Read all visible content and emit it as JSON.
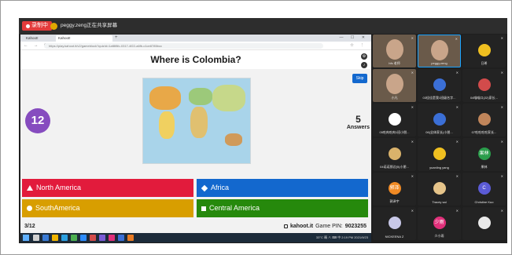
{
  "meeting": {
    "record_label": "录制中",
    "sharer_label": "peggy.zeng正在共享屏幕"
  },
  "browser": {
    "tabs": [
      "Kahoot!",
      "Kahoot!"
    ],
    "url": "https://play.kahoot.it/v2/gameblock?quizId=1af8f8fc-0317-4f22-a6fb-c1ce8785bcc",
    "window_controls": "— ☐ ✕"
  },
  "kahoot": {
    "question": "Where is Colombia?",
    "skip_label": "Skip",
    "timer": "12",
    "answers_count": "5",
    "answers_label": "Answers",
    "choices": [
      {
        "label": "North America",
        "shape": "triangle",
        "color": "#e21b3c"
      },
      {
        "label": "Africa",
        "shape": "diamond",
        "color": "#1368ce"
      },
      {
        "label": "SouthAmerica",
        "shape": "circle",
        "color": "#d89e00"
      },
      {
        "label": "Central America",
        "shape": "square",
        "color": "#26890c"
      }
    ],
    "progress": "3/12",
    "site": "kahoot.it",
    "game_pin_label": "Game PIN:",
    "game_pin": "9023255"
  },
  "taskbar": {
    "tray_text": "33°C 晴 ∧ ⌨ 中 2:19 PM 2021/9/23"
  },
  "participants": [
    {
      "name": "hfs 老师",
      "video": true
    },
    {
      "name": "peggy.zeng",
      "video": true,
      "active": true
    },
    {
      "name": "日希",
      "video": false,
      "avatar_color": "#f0c020"
    },
    {
      "name": "小凡",
      "video": true
    },
    {
      "name": "03佳佳是我1班级名字...",
      "video": false,
      "avatar_color": "#3b6fd6"
    },
    {
      "name": "04喵喵口(22)家长...",
      "video": false,
      "avatar_color": "#d24b4b"
    },
    {
      "name": "05吃肉吃肉1班小朋...",
      "video": false,
      "avatar_color": "#ffffff"
    },
    {
      "name": "06(全体家长)小朋...",
      "video": false,
      "avatar_color": "#3b6fd6"
    },
    {
      "name": "07吃吃吃吃家长...",
      "video": false,
      "avatar_color": "#c0855a"
    },
    {
      "name": "04诺诺那边(5)小朋...",
      "video": false,
      "avatar_color": "#d9b26b"
    },
    {
      "name": "yuanling yang",
      "video": false,
      "avatar_color": "#f0c020"
    },
    {
      "name": "果林",
      "video": false,
      "avatar_color": "#2a9d4b",
      "letter": "果林"
    },
    {
      "name": "郭泽宇",
      "video": false,
      "avatar_color": "#f08a24",
      "letter": "郭泽"
    },
    {
      "name": "Tracey sai",
      "video": false,
      "avatar_color": "#e6c48a"
    },
    {
      "name": "Christine Kuo",
      "video": false,
      "avatar_color": "#5b5bd6",
      "letter": "C"
    },
    {
      "name": "NICKEENA Z",
      "video": false,
      "avatar_color": "#c8c8e8"
    },
    {
      "name": "少小雨",
      "video": false,
      "avatar_color": "#e0307a",
      "letter": "少雨"
    },
    {
      "name": "",
      "video": false,
      "avatar_color": "#eaeaea"
    }
  ]
}
